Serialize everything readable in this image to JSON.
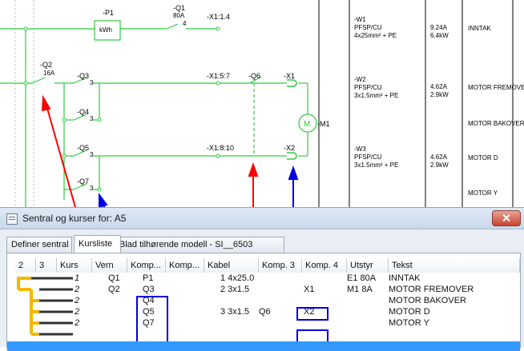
{
  "schematic": {
    "labels": {
      "p1": "-P1",
      "kwh": "kWh",
      "q1": "-Q1",
      "q1_rating": "80A",
      "q1_pin": "4",
      "x1_1_4": "-X1:1.4",
      "q2": "-Q2",
      "q2_rating": "16A",
      "q3": "-Q3",
      "q3_pin": "3",
      "q4": "-Q4",
      "q4_pin": "3",
      "q5": "-Q5",
      "q5_pin": "3",
      "q7": "-Q7",
      "q7_pin": "3",
      "x1_5_7": "-X1:5:7",
      "q6": "-Q6",
      "x1": "-X1",
      "m1": "-M1",
      "x1_8_10": "-X1:8:10",
      "x2": "-X2"
    },
    "cables": [
      {
        "id": "-W1",
        "type": "PFSP/CU",
        "size": "4x25mm² + PE",
        "current": "9.24A",
        "power": "6.4kW",
        "text": "INNTAK"
      },
      {
        "id": "-W2",
        "type": "PFSP/CU",
        "size": "3x1.5mm² + PE",
        "current": "4.62A",
        "power": "2.9kW",
        "text": "MOTOR FREMOVER"
      },
      {
        "id": "",
        "type": "",
        "size": "",
        "current": "",
        "power": "",
        "text": "MOTOR BAKOVER"
      },
      {
        "id": "-W3",
        "type": "PFSP/CU",
        "size": "3x1.5mm² + PE",
        "current": "4.62A",
        "power": "2.9kW",
        "text": "MOTOR D"
      },
      {
        "id": "",
        "type": "",
        "size": "",
        "current": "",
        "power": "",
        "text": "MOTOR Y"
      }
    ],
    "colors": {
      "wire": "#2ecc40",
      "arrow_red": "#ff0000",
      "arrow_blue": "#0000e0",
      "annotation": "#0000e0"
    }
  },
  "window": {
    "title": "Sentral og kurser for: A5",
    "tabs": [
      "Definer sentral",
      "Kursliste",
      "Blad tilhørende modell - SI__6503"
    ],
    "active_tab": 1,
    "columns": [
      "2",
      "3",
      "Kurs",
      "Vern",
      "Komp...",
      "Komp...",
      "Kabel",
      "Komp. 3",
      "Komp. 4",
      "Utstyr",
      "Tekst"
    ],
    "rows": [
      {
        "kurs": "1",
        "vern": "Q1",
        "komp1": "P1",
        "komp2": "",
        "kabel": "1 4x25.0",
        "komp3": "",
        "komp4": "",
        "utstyr": "E1 80A",
        "tekst": "INNTAK"
      },
      {
        "kurs": "2",
        "vern": "Q2",
        "komp1": "Q3",
        "komp2": "",
        "kabel": "2 3x1.5",
        "komp3": "",
        "komp4": "X1",
        "utstyr": "M1 8A",
        "tekst": "MOTOR FREMOVER"
      },
      {
        "kurs": "2",
        "vern": "",
        "komp1": "Q4",
        "komp2": "",
        "kabel": "",
        "komp3": "",
        "komp4": "",
        "utstyr": "",
        "tekst": "MOTOR BAKOVER"
      },
      {
        "kurs": "2",
        "vern": "",
        "komp1": "Q5",
        "komp2": "",
        "kabel": "3 3x1.5",
        "komp3": "Q6",
        "komp4": "X2",
        "utstyr": "",
        "tekst": "MOTOR D"
      },
      {
        "kurs": "2",
        "vern": "",
        "komp1": "Q7",
        "komp2": "",
        "kabel": "",
        "komp3": "",
        "komp4": "",
        "utstyr": "",
        "tekst": "MOTOR Y"
      }
    ],
    "colors": {
      "selected_row": "#3399ff",
      "tree_lines": "#f2b800"
    }
  }
}
